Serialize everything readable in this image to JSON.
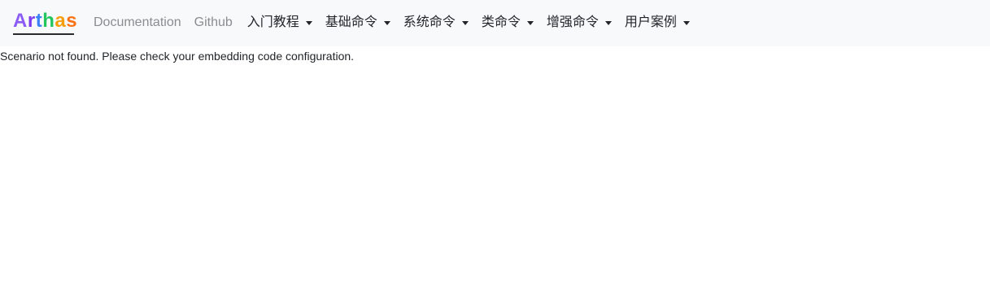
{
  "navbar": {
    "brand": {
      "text": "Arthas",
      "letters": [
        "A",
        "r",
        "t",
        "h",
        "a",
        "s"
      ],
      "letter_colors": [
        "#8b5cf6",
        "#7c3aed",
        "#3b82f6",
        "#22c55e",
        "#f59e0b",
        "#f97316"
      ]
    },
    "links": [
      {
        "label": "Documentation"
      },
      {
        "label": "Github"
      }
    ],
    "dropdowns": [
      {
        "label": "入门教程"
      },
      {
        "label": "基础命令"
      },
      {
        "label": "系统命令"
      },
      {
        "label": "类命令"
      },
      {
        "label": "增强命令"
      },
      {
        "label": "用户案例"
      }
    ]
  },
  "main": {
    "message": "Scenario not found. Please check your embedding code configuration."
  }
}
